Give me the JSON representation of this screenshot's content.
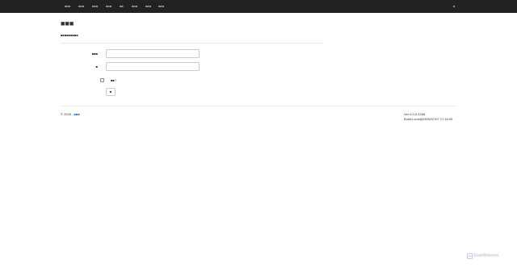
{
  "navbar": {
    "items": [
      {
        "label": "■■■"
      },
      {
        "label": "■■■"
      },
      {
        "label": "■■■"
      },
      {
        "label": "■■■"
      },
      {
        "label": "■■"
      },
      {
        "label": "■■■"
      },
      {
        "label": "■■■"
      },
      {
        "label": "■■■"
      }
    ],
    "right_label": "■"
  },
  "page": {
    "title": "■■■",
    "subtitle": "■■■■■■■■■"
  },
  "form": {
    "username_label": "■■■",
    "password_label": "■",
    "remember_label": "■■?",
    "submit_label": "■"
  },
  "footer": {
    "copyright": "© 2026 - ",
    "copyright_link": "■■■",
    "version": "Ver:3.0.0.2268",
    "build": "Build:Local@2025/07/07 17:16:05"
  },
  "watermark": {
    "text": "ScanMalware"
  }
}
